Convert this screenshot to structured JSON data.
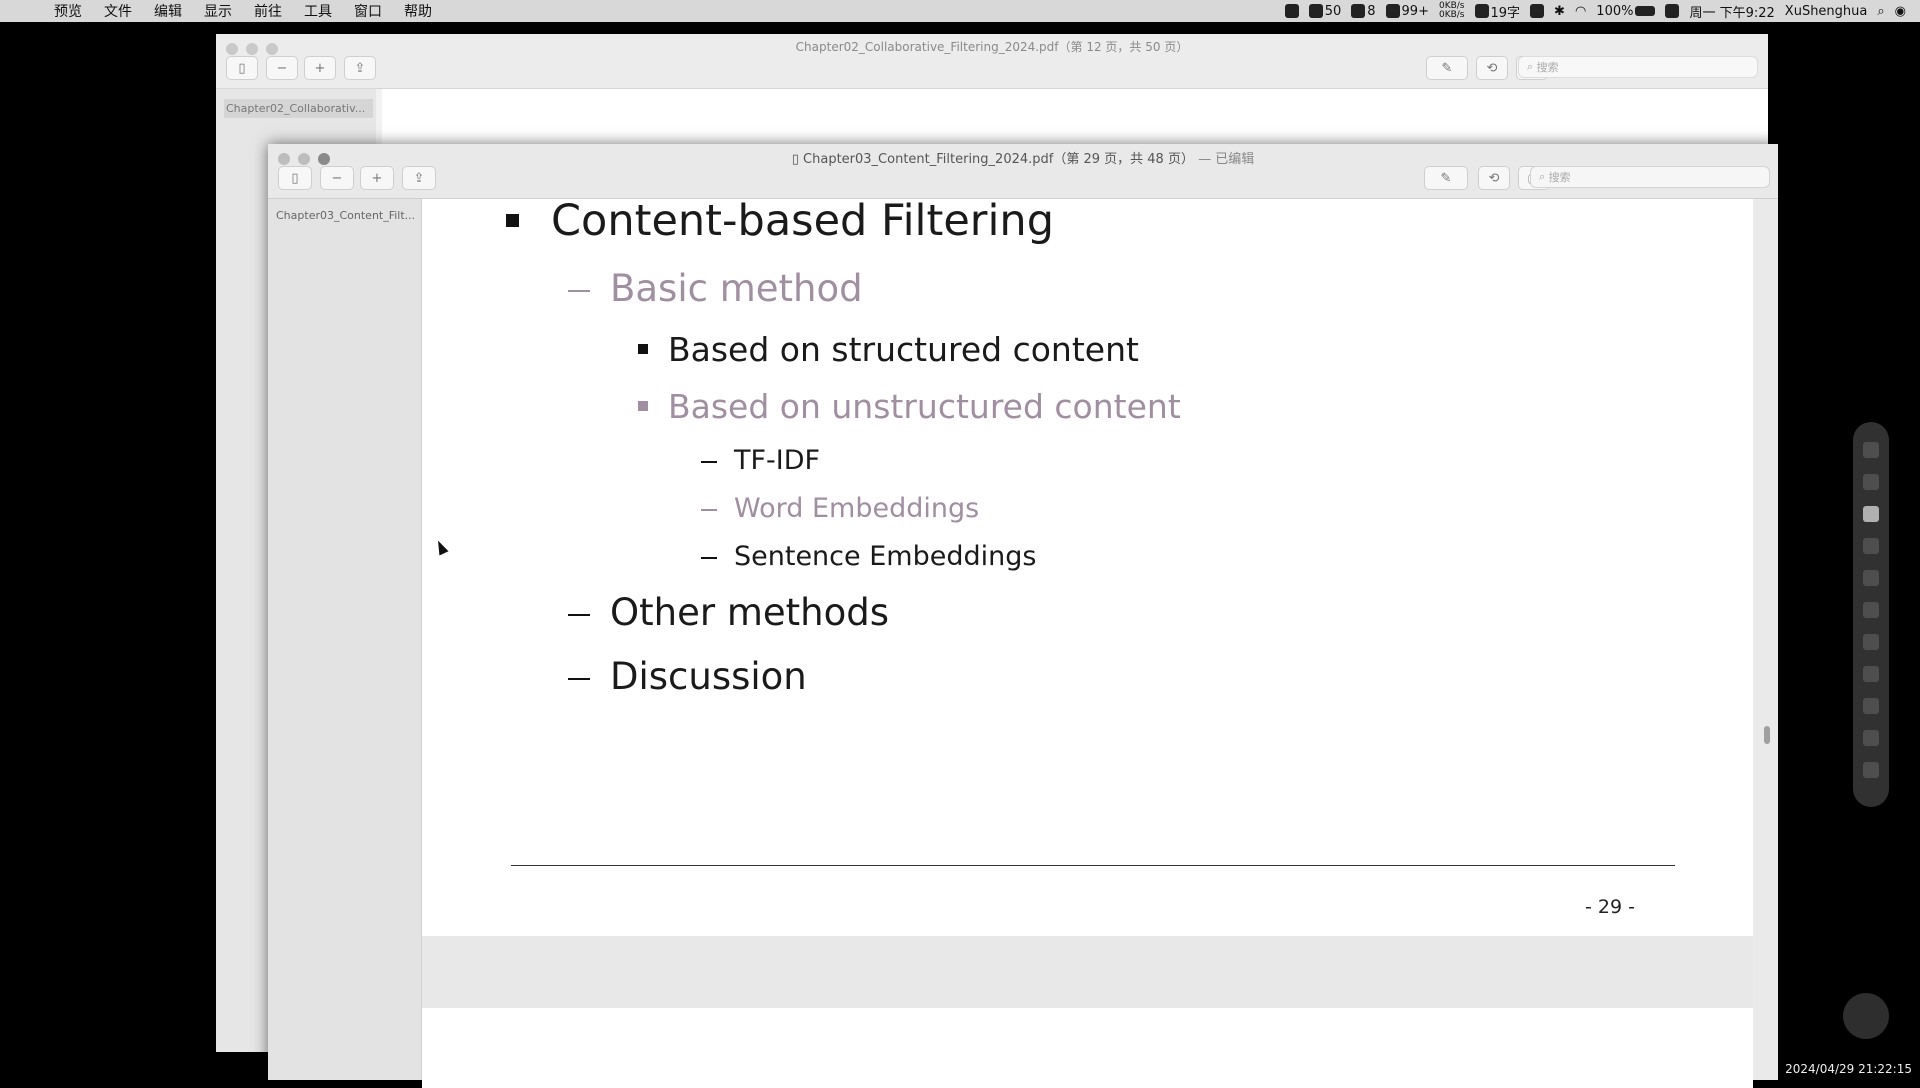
{
  "menubar": {
    "apple_icon": "apple-logo-icon",
    "items": [
      "预览",
      "文件",
      "编辑",
      "显示",
      "前往",
      "工具",
      "窗口",
      "帮助"
    ],
    "status": {
      "badge1": "50",
      "badge2": "8",
      "badge3": "99+",
      "net_up": "0KB/s",
      "net_down": "0KB/s",
      "temp": "19字",
      "battery": "100%",
      "clock": "周一 下午9:22",
      "user": "XuShenghua"
    }
  },
  "window_back": {
    "title": "Chapter02_Collaborative_Filtering_2024.pdf（第 12 页，共 50 页）",
    "search_placeholder": "搜索",
    "sidebar_thumb": "Chapter02_Collaborativ..."
  },
  "window_front": {
    "title": "Chapter03_Content_Filtering_2024.pdf（第 29 页，共 48 页）",
    "edited": "— 已编辑",
    "search_placeholder": "搜索",
    "sidebar_thumb": "Chapter03_Content_Filt..."
  },
  "slide": {
    "heading": "Content-based Filtering",
    "sub1": "Basic method",
    "sub1_a": "Based on structured content",
    "sub1_b": "Based on unstructured content",
    "sub1_b_1": "TF-IDF",
    "sub1_b_2": "Word Embeddings",
    "sub1_b_3": "Sentence Embeddings",
    "sub2": "Other methods",
    "sub3": "Discussion",
    "page_number": "- 29 -",
    "colors": {
      "active": "#1a1a1a",
      "dimmed": "#a08fa0"
    }
  },
  "screen_timestamp": "2024/04/29 21:22:15"
}
